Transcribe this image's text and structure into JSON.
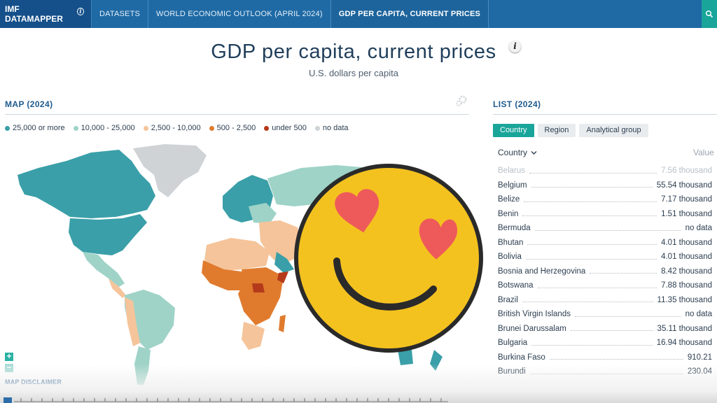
{
  "nav": {
    "brand": "IMF DATAMAPPER",
    "brand_info": "i",
    "items": [
      "DATASETS",
      "WORLD ECONOMIC OUTLOOK (APRIL 2024)",
      "GDP PER CAPITA, CURRENT PRICES"
    ],
    "search_icon": "search-icon"
  },
  "title": "GDP per capita, current prices",
  "title_info": "i",
  "subtitle": "U.S. dollars per capita",
  "map": {
    "header": "MAP (2024)",
    "legend": [
      {
        "label": "25,000 or more",
        "color": "#3a9fa8"
      },
      {
        "label": "10,000 - 25,000",
        "color": "#9fd3c7"
      },
      {
        "label": "2,500 - 10,000",
        "color": "#f5c49a"
      },
      {
        "label": "500 - 2,500",
        "color": "#e07b2e"
      },
      {
        "label": "under 500",
        "color": "#b53a1a"
      },
      {
        "label": "no data",
        "color": "#cfd3d6"
      }
    ],
    "zoom_in": "+",
    "zoom_out": "−",
    "disclaimer": "MAP DISCLAIMER"
  },
  "list": {
    "header": "LIST (2024)",
    "tabs": [
      "Country",
      "Region",
      "Analytical group"
    ],
    "col_country": "Country",
    "col_value": "Value",
    "rows": [
      {
        "name": "Belarus",
        "value": "7.56 thousand"
      },
      {
        "name": "Belgium",
        "value": "55.54 thousand"
      },
      {
        "name": "Belize",
        "value": "7.17 thousand"
      },
      {
        "name": "Benin",
        "value": "1.51 thousand"
      },
      {
        "name": "Bermuda",
        "value": "no data"
      },
      {
        "name": "Bhutan",
        "value": "4.01 thousand"
      },
      {
        "name": "Bolivia",
        "value": "4.01 thousand"
      },
      {
        "name": "Bosnia and Herzegovina",
        "value": "8.42 thousand"
      },
      {
        "name": "Botswana",
        "value": "7.88 thousand"
      },
      {
        "name": "Brazil",
        "value": "11.35 thousand"
      },
      {
        "name": "British Virgin Islands",
        "value": "no data"
      },
      {
        "name": "Brunei Darussalam",
        "value": "35.11 thousand"
      },
      {
        "name": "Bulgaria",
        "value": "16.94 thousand"
      },
      {
        "name": "Burkina Faso",
        "value": "910.21"
      },
      {
        "name": "Burundi",
        "value": "230.04"
      }
    ]
  },
  "colors": {
    "nav_bg": "#1f6aa5",
    "accent": "#1aa59a",
    "high": "#3a9fa8",
    "upper_mid": "#9fd3c7",
    "mid": "#f5c49a",
    "low": "#e07b2e",
    "lowest": "#b53a1a",
    "no_data": "#cfd3d6"
  },
  "overlay_icon": "heart-eyes-emoji-icon"
}
